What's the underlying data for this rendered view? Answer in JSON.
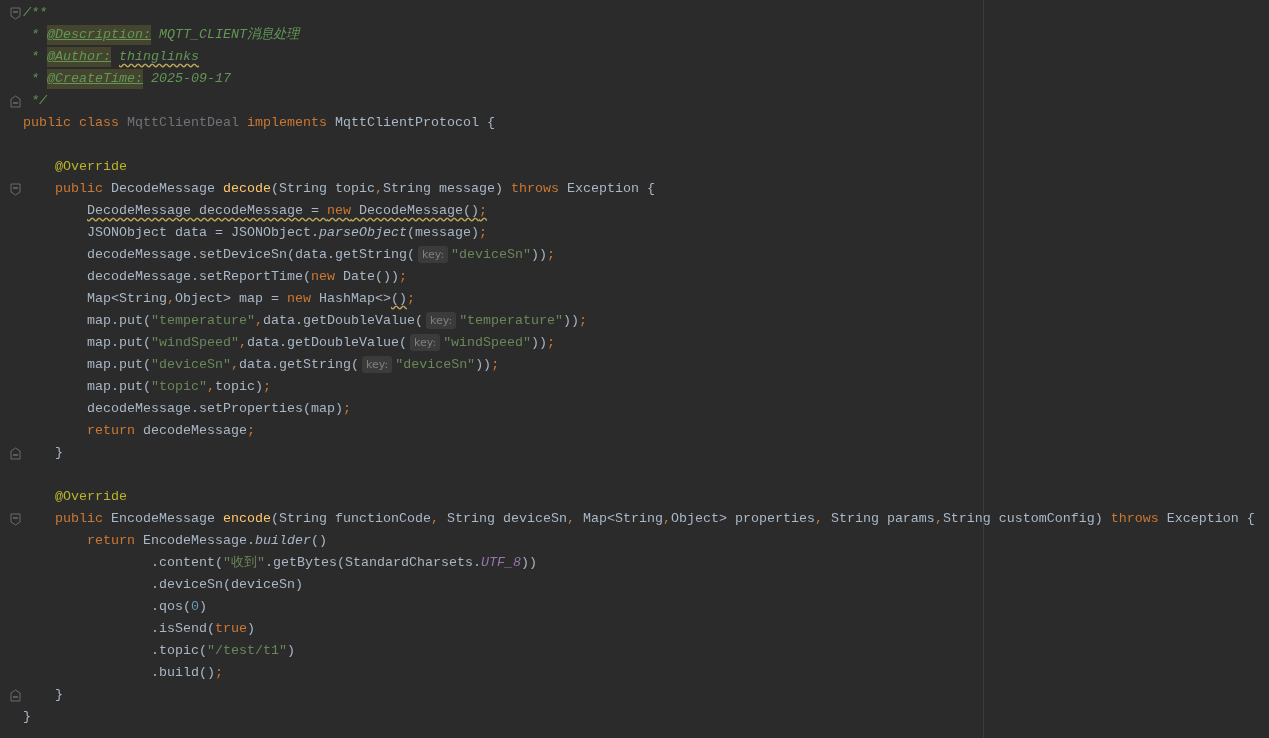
{
  "editor": {
    "lines": [
      {
        "fold_start": true,
        "tokens": [
          {
            "text": "/**",
            "kind": "comment"
          }
        ]
      },
      {
        "kind": "doc",
        "tokens": [
          {
            "text": "* ",
            "kind": "comment"
          },
          {
            "text": "@Description:",
            "kind": "doc_tag"
          },
          {
            "text": " MQTT_CLIENT消息处理",
            "kind": "comment"
          }
        ]
      },
      {
        "kind": "doc",
        "tokens": [
          {
            "text": "* ",
            "kind": "comment"
          },
          {
            "text": "@Author:",
            "kind": "doc_tag"
          },
          {
            "text": "thinglinks",
            "kind": "doc_value",
            "warning": true
          }
        ]
      },
      {
        "kind": "doc",
        "tokens": [
          {
            "text": "* ",
            "kind": "comment"
          },
          {
            "text": "@CreateTime:",
            "kind": "doc_tag"
          },
          {
            "text": " 2025-09-17",
            "kind": "comment"
          }
        ]
      },
      {
        "kind": "doc",
        "fold_end": true,
        "tokens": [
          {
            "text": "*/",
            "kind": "comment"
          }
        ]
      },
      {
        "tokens": [
          {
            "text": "public class ",
            "kind": "keyword"
          },
          {
            "text": "MqttClientDeal",
            "kind": "unused"
          },
          {
            "text": " implements ",
            "kind": "keyword"
          },
          {
            "text": "MqttClientProtocol {",
            "kind": "plain"
          }
        ],
        "children": [
          {
            "kind": "blank"
          },
          {
            "tokens": [
              {
                "text": "@Override",
                "kind": "annotation"
              }
            ]
          },
          {
            "fold_start": true,
            "tokens": [
              {
                "text": "public ",
                "kind": "keyword"
              },
              {
                "text": "DecodeMessage ",
                "kind": "plain"
              },
              {
                "text": "decode",
                "kind": "declaration"
              },
              {
                "text": "(String topic",
                "kind": "plain"
              },
              {
                "text": ",",
                "kind": "punct"
              },
              {
                "text": "String message) ",
                "kind": "plain"
              },
              {
                "text": "throws ",
                "kind": "keyword"
              },
              {
                "text": "Exception {",
                "kind": "plain"
              }
            ],
            "children": [
              {
                "tokens": [
                  {
                    "text": "DecodeMessage decodeMessage = ",
                    "kind": "plain",
                    "warning": true
                  },
                  {
                    "text": "new",
                    "kind": "keyword",
                    "warning": true
                  },
                  {
                    "text": " DecodeMessage()",
                    "kind": "plain",
                    "warning": true
                  },
                  {
                    "text": ";",
                    "kind": "punct",
                    "warning": true
                  }
                ]
              },
              {
                "tokens": [
                  {
                    "text": "JSONObject data = JSONObject.",
                    "kind": "plain"
                  },
                  {
                    "text": "parseObject",
                    "kind": "static_call"
                  },
                  {
                    "text": "(message)",
                    "kind": "plain"
                  },
                  {
                    "text": ";",
                    "kind": "punct"
                  }
                ]
              },
              {
                "tokens": [
                  {
                    "text": "decodeMessage.setDeviceSn(data.getString(",
                    "kind": "plain"
                  },
                  {
                    "text": "key:",
                    "kind": "hint"
                  },
                  {
                    "text": "\"deviceSn\"",
                    "kind": "string"
                  },
                  {
                    "text": "))",
                    "kind": "plain"
                  },
                  {
                    "text": ";",
                    "kind": "punct"
                  }
                ]
              },
              {
                "tokens": [
                  {
                    "text": "decodeMessage.setReportTime(",
                    "kind": "plain"
                  },
                  {
                    "text": "new",
                    "kind": "keyword"
                  },
                  {
                    "text": " Date())",
                    "kind": "plain"
                  },
                  {
                    "text": ";",
                    "kind": "punct"
                  }
                ]
              },
              {
                "tokens": [
                  {
                    "text": "Map<String",
                    "kind": "plain"
                  },
                  {
                    "text": ",",
                    "kind": "punct"
                  },
                  {
                    "text": "Object> map = ",
                    "kind": "plain"
                  },
                  {
                    "text": "new",
                    "kind": "keyword"
                  },
                  {
                    "text": " HashMap<>",
                    "kind": "plain"
                  },
                  {
                    "text": "()",
                    "kind": "plain",
                    "warning": true
                  },
                  {
                    "text": ";",
                    "kind": "punct"
                  }
                ]
              },
              {
                "tokens": [
                  {
                    "text": "map.put(",
                    "kind": "plain"
                  },
                  {
                    "text": "\"temperature\"",
                    "kind": "string"
                  },
                  {
                    "text": ",",
                    "kind": "punct"
                  },
                  {
                    "text": "data.getDoubleValue(",
                    "kind": "plain"
                  },
                  {
                    "text": "key:",
                    "kind": "hint"
                  },
                  {
                    "text": "\"temperature\"",
                    "kind": "string"
                  },
                  {
                    "text": "))",
                    "kind": "plain"
                  },
                  {
                    "text": ";",
                    "kind": "punct"
                  }
                ]
              },
              {
                "tokens": [
                  {
                    "text": "map.put(",
                    "kind": "plain"
                  },
                  {
                    "text": "\"windSpeed\"",
                    "kind": "string"
                  },
                  {
                    "text": ",",
                    "kind": "punct"
                  },
                  {
                    "text": "data.getDoubleValue(",
                    "kind": "plain"
                  },
                  {
                    "text": "key:",
                    "kind": "hint"
                  },
                  {
                    "text": "\"windSpeed\"",
                    "kind": "string"
                  },
                  {
                    "text": "))",
                    "kind": "plain"
                  },
                  {
                    "text": ";",
                    "kind": "punct"
                  }
                ]
              },
              {
                "tokens": [
                  {
                    "text": "map.put(",
                    "kind": "plain"
                  },
                  {
                    "text": "\"deviceSn\"",
                    "kind": "string"
                  },
                  {
                    "text": ",",
                    "kind": "punct"
                  },
                  {
                    "text": "data.getString(",
                    "kind": "plain"
                  },
                  {
                    "text": "key:",
                    "kind": "hint"
                  },
                  {
                    "text": "\"deviceSn\"",
                    "kind": "string"
                  },
                  {
                    "text": "))",
                    "kind": "plain"
                  },
                  {
                    "text": ";",
                    "kind": "punct"
                  }
                ]
              },
              {
                "tokens": [
                  {
                    "text": "map.put(",
                    "kind": "plain"
                  },
                  {
                    "text": "\"topic\"",
                    "kind": "string"
                  },
                  {
                    "text": ",",
                    "kind": "punct"
                  },
                  {
                    "text": "topic)",
                    "kind": "plain"
                  },
                  {
                    "text": ";",
                    "kind": "punct"
                  }
                ]
              },
              {
                "tokens": [
                  {
                    "text": "decodeMessage.setProperties(map)",
                    "kind": "plain"
                  },
                  {
                    "text": ";",
                    "kind": "punct"
                  }
                ]
              },
              {
                "tokens": [
                  {
                    "text": "return",
                    "kind": "keyword"
                  },
                  {
                    "text": " decodeMessage",
                    "kind": "plain"
                  },
                  {
                    "text": ";",
                    "kind": "punct"
                  }
                ]
              }
            ]
          },
          {
            "fold_end": true,
            "tokens": [
              {
                "text": "}",
                "kind": "plain"
              }
            ]
          },
          {
            "kind": "blank"
          },
          {
            "tokens": [
              {
                "text": "@Override",
                "kind": "annotation"
              }
            ]
          },
          {
            "fold_start": true,
            "tokens": [
              {
                "text": "public ",
                "kind": "keyword"
              },
              {
                "text": "EncodeMessage ",
                "kind": "plain"
              },
              {
                "text": "encode",
                "kind": "declaration"
              },
              {
                "text": "(String functionCode",
                "kind": "plain"
              },
              {
                "text": ", ",
                "kind": "punct"
              },
              {
                "text": "String deviceSn",
                "kind": "plain"
              },
              {
                "text": ", ",
                "kind": "punct"
              },
              {
                "text": "Map<String",
                "kind": "plain"
              },
              {
                "text": ",",
                "kind": "punct"
              },
              {
                "text": "Object> properties",
                "kind": "plain"
              },
              {
                "text": ", ",
                "kind": "punct"
              },
              {
                "text": "String params",
                "kind": "plain"
              },
              {
                "text": ",",
                "kind": "punct"
              },
              {
                "text": "String customConfig) ",
                "kind": "plain"
              },
              {
                "text": "throws ",
                "kind": "keyword"
              },
              {
                "text": "Exception {",
                "kind": "plain"
              }
            ],
            "children": [
              {
                "tokens": [
                  {
                    "text": "return ",
                    "kind": "keyword"
                  },
                  {
                    "text": "EncodeMessage.",
                    "kind": "plain"
                  },
                  {
                    "text": "builder",
                    "kind": "static_call"
                  },
                  {
                    "text": "()",
                    "kind": "plain"
                  }
                ],
                "children": [
                  {
                    "kind": "continuation",
                    "tokens": [
                      {
                        "text": ".content(",
                        "kind": "plain"
                      },
                      {
                        "text": "\"收到\"",
                        "kind": "string"
                      },
                      {
                        "text": ".getBytes(StandardCharsets.",
                        "kind": "plain"
                      },
                      {
                        "text": "UTF_8",
                        "kind": "constant"
                      },
                      {
                        "text": "))",
                        "kind": "plain"
                      }
                    ]
                  },
                  {
                    "kind": "continuation",
                    "tokens": [
                      {
                        "text": ".deviceSn(deviceSn)",
                        "kind": "plain"
                      }
                    ]
                  },
                  {
                    "kind": "continuation",
                    "tokens": [
                      {
                        "text": ".qos(",
                        "kind": "plain"
                      },
                      {
                        "text": "0",
                        "kind": "number"
                      },
                      {
                        "text": ")",
                        "kind": "plain"
                      }
                    ]
                  },
                  {
                    "kind": "continuation",
                    "tokens": [
                      {
                        "text": ".isSend(",
                        "kind": "plain"
                      },
                      {
                        "text": "true",
                        "kind": "keyword"
                      },
                      {
                        "text": ")",
                        "kind": "plain"
                      }
                    ]
                  },
                  {
                    "kind": "continuation",
                    "tokens": [
                      {
                        "text": ".topic(",
                        "kind": "plain"
                      },
                      {
                        "text": "\"/test/t1\"",
                        "kind": "string"
                      },
                      {
                        "text": ")",
                        "kind": "plain"
                      }
                    ]
                  },
                  {
                    "kind": "continuation",
                    "tokens": [
                      {
                        "text": ".build()",
                        "kind": "plain"
                      },
                      {
                        "text": ";",
                        "kind": "punct"
                      }
                    ]
                  }
                ]
              }
            ]
          },
          {
            "fold_end": true,
            "tokens": [
              {
                "text": "}",
                "kind": "plain"
              }
            ]
          }
        ]
      },
      {
        "tokens": [
          {
            "text": "}",
            "kind": "plain"
          }
        ]
      }
    ]
  }
}
